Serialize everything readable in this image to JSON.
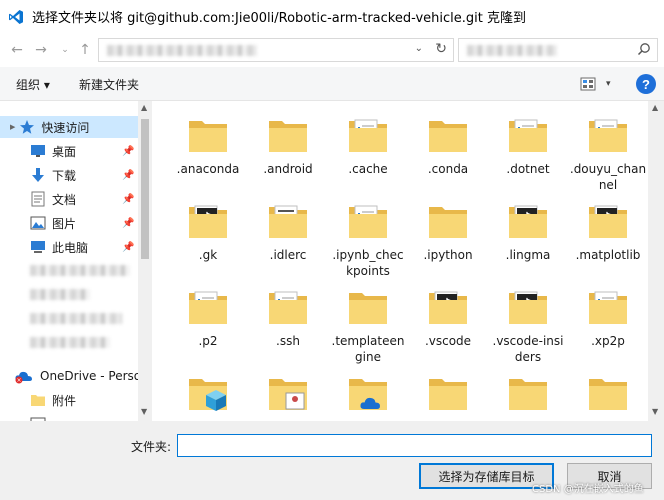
{
  "window": {
    "title": "选择文件夹以将 git@github.com:Jie00li/Robotic-arm-tracked-vehicle.git 克隆到"
  },
  "toolbar": {
    "organize_label": "组织 ▾",
    "new_folder_label": "新建文件夹",
    "help_label": "?"
  },
  "sidebar": {
    "items": [
      {
        "label": "快速访问",
        "icon": "star-icon"
      },
      {
        "label": "桌面",
        "icon": "desktop-icon"
      },
      {
        "label": "下载",
        "icon": "download-icon"
      },
      {
        "label": "文档",
        "icon": "document-icon"
      },
      {
        "label": "图片",
        "icon": "picture-icon"
      },
      {
        "label": "此电脑",
        "icon": "computer-icon"
      },
      {
        "label": "OneDrive - Perso",
        "icon": "onedrive-icon"
      },
      {
        "label": "附件",
        "icon": "folder-icon"
      }
    ]
  },
  "files": [
    {
      "name": ".anaconda",
      "icon": "folder"
    },
    {
      "name": ".android",
      "icon": "folder"
    },
    {
      "name": ".cache",
      "icon": "folder-docs"
    },
    {
      "name": ".conda",
      "icon": "folder"
    },
    {
      "name": ".dotnet",
      "icon": "folder-docs"
    },
    {
      "name": ".douyu_channel",
      "icon": "folder-docs"
    },
    {
      "name": ".gk",
      "icon": "folder-music"
    },
    {
      "name": ".idlerc",
      "icon": "folder-text"
    },
    {
      "name": ".ipynb_checkpoints",
      "icon": "folder-docs"
    },
    {
      "name": ".ipython",
      "icon": "folder"
    },
    {
      "name": ".lingma",
      "icon": "folder-music"
    },
    {
      "name": ".matplotlib",
      "icon": "folder-music"
    },
    {
      "name": ".p2",
      "icon": "folder-docs"
    },
    {
      "name": ".ssh",
      "icon": "folder-docs"
    },
    {
      "name": ".templateengine",
      "icon": "folder"
    },
    {
      "name": ".vscode",
      "icon": "folder-music"
    },
    {
      "name": ".vscode-insiders",
      "icon": "folder-music"
    },
    {
      "name": ".xp2p",
      "icon": "folder-docs"
    },
    {
      "name": "",
      "icon": "folder-3d"
    },
    {
      "name": "",
      "icon": "folder-contacts"
    },
    {
      "name": "",
      "icon": "folder-onedrive"
    },
    {
      "name": "",
      "icon": "folder"
    },
    {
      "name": "",
      "icon": "folder"
    },
    {
      "name": "",
      "icon": "folder"
    }
  ],
  "bottom": {
    "folder_label": "文件夹:",
    "folder_value": "",
    "save_label": "选择为存储库目标",
    "cancel_label": "取消"
  },
  "watermark": "CSDN @沉在嵌入式的鱼",
  "colors": {
    "accent": "#0078d7",
    "selection": "#cce8ff",
    "folder": "#f8d775"
  }
}
